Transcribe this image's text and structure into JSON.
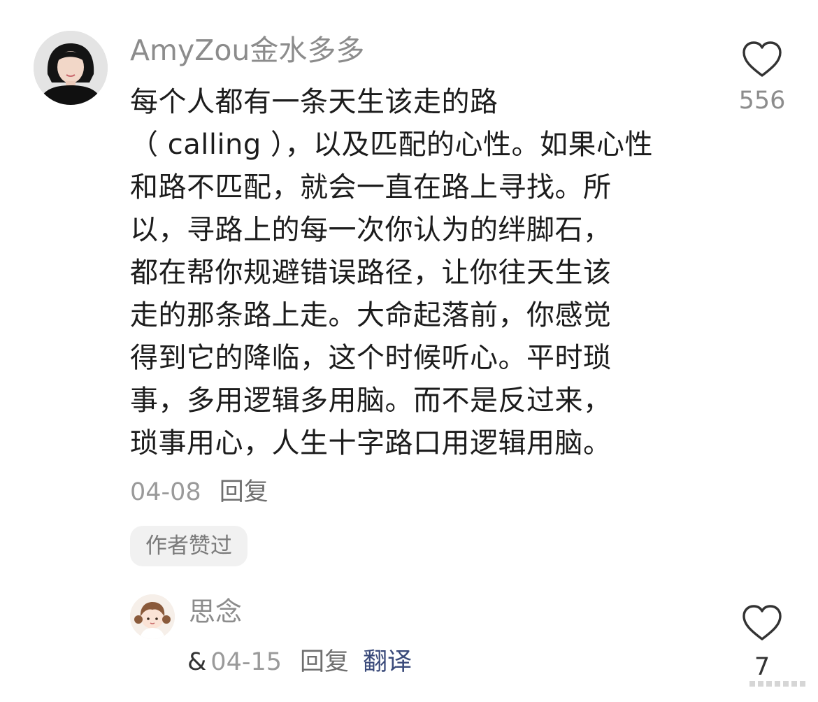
{
  "main_comment": {
    "username": "AmyZou金水多多",
    "text_lines": [
      "每个人都有一条天生该走的路",
      "（ calling ），以及匹配的心性。如果心性",
      "和路不匹配，就会一直在路上寻找。所",
      "以，寻路上的每一次你认为的绊脚石，",
      "都在帮你规避错误路径，让你往天生该",
      "走的那条路上走。大命起落前，你感觉",
      "得到它的降临，这个时候听心。平时琐",
      "事，多用逻辑多用脑。而不是反过来，",
      "琐事用心，人生十字路口用逻辑用脑。"
    ],
    "date": "04-08",
    "reply_label": "回复",
    "author_liked_badge": "作者赞过",
    "like_count": "556",
    "like_icon": "heart-outline-icon"
  },
  "reply_comment": {
    "username": "思念",
    "prefix_symbol": "&",
    "date": "04-15",
    "reply_label": "回复",
    "translate_label": "翻译",
    "like_count": "7",
    "like_icon": "heart-outline-icon"
  },
  "colors": {
    "username": "#8c8c8c",
    "body_text": "#1c1c1c",
    "meta": "#9a9a9a",
    "translate_link": "#3a4a7a",
    "badge_bg": "#f1f1f1"
  }
}
